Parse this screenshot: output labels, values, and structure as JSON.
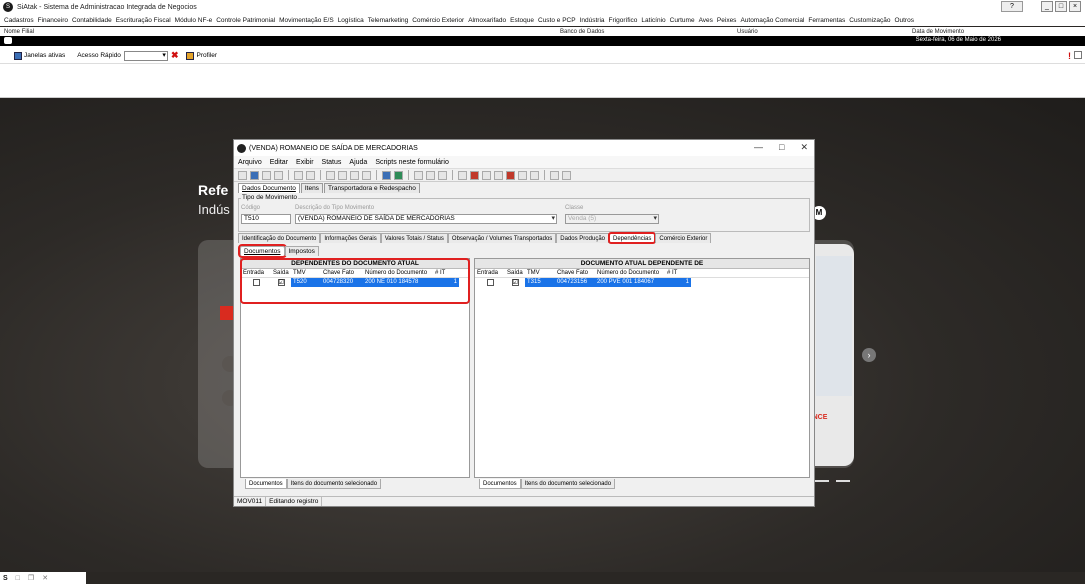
{
  "app": {
    "logo": "S",
    "title": "SiAtak - Sistema de Administracao Integrada de Negocios",
    "help_label": "?",
    "controls": [
      "_",
      "□",
      "×"
    ]
  },
  "menu": [
    "Cadastros",
    "Financeiro",
    "Contabilidade",
    "Escrituração Fiscal",
    "Módulo NF-e",
    "Controle Patrimonial",
    "Movimentação E/S",
    "Logística",
    "Telemarketing",
    "Comércio Exterior",
    "Almoxarifado",
    "Estoque",
    "Custo e PCP",
    "Indústria",
    "Frigorífico",
    "Laticínio",
    "Curtume",
    "Aves",
    "Peixes",
    "Automação Comercial",
    "Ferramentas",
    "Customização",
    "Outros"
  ],
  "info": {
    "nome_filial_label": "Nome Filial",
    "banco_label": "Banco de Dados",
    "usuario_label": "Usuário",
    "data_label": "Data de Movimento",
    "data_value": "Sexta-feira, 06 de Maio de 2026"
  },
  "toolbar": {
    "janelas_label": "Janelas ativas",
    "acesso_label": "Acesso Rápido",
    "profiler_label": "Profiler",
    "alert_icon": "!"
  },
  "background": {
    "title": "Refe",
    "subtitle": "Indús",
    "badge_text": "IENCE",
    "chevron": "M",
    "arrow": "›"
  },
  "dialog": {
    "title": "(VENDA) ROMANEIO DE SAÍDA DE MERCADORIAS",
    "controls": [
      "—",
      "□",
      "✕"
    ],
    "menu": [
      "Arquivo",
      "Editar",
      "Exibir",
      "Status",
      "Ajuda",
      "Scripts neste formulário"
    ],
    "main_tabs": [
      "Dados Documento",
      "Itens",
      "Transportadora e Redespacho"
    ],
    "group_label": "Tipo de Movimento",
    "codigo_label": "Código",
    "codigo_value": "T510",
    "descricao_label": "Descrição do Tipo Movimento",
    "descricao_value": "(VENDA) ROMANEIO DE SAÍDA DE MERCADORIAS",
    "classe_label": "Classe",
    "classe_value": "Venda (5)",
    "sub_tabs": [
      "Identificação do Documento",
      "Informações Gerais",
      "Valores Totais / Status",
      "Observação / Volumes Transportados",
      "Dados Produção",
      "Dependências",
      "Comércio Exterior"
    ],
    "doc_tabs": [
      "Documentos",
      "Impostos"
    ],
    "left_panel": {
      "header": "DEPENDENTES DO DOCUMENTO ATUAL",
      "columns": [
        "Entrada",
        "Saída",
        "TMV",
        "Chave Fato",
        "Número do Documento",
        "# IT"
      ],
      "rows": [
        {
          "entrada": "",
          "saida": "☑",
          "tmv": "T520",
          "chave": "004728320",
          "numero": "200 NE 010 184578",
          "it": "1"
        }
      ],
      "footer_tabs": [
        "Documentos",
        "Itens do documento selecionado"
      ]
    },
    "right_panel": {
      "header": "DOCUMENTO ATUAL DEPENDENTE DE",
      "columns": [
        "Entrada",
        "Saída",
        "TMV",
        "Chave Fato",
        "Número do Documento",
        "# IT"
      ],
      "rows": [
        {
          "entrada": "",
          "saida": "☑",
          "tmv": "T315",
          "chave": "004723156",
          "numero": "200 PVE 001 184067",
          "it": "1"
        }
      ],
      "footer_tabs": [
        "Documentos",
        "Itens do documento selecionado"
      ]
    },
    "status": [
      "MOV011",
      "Editando registro"
    ]
  },
  "taskbar": {
    "items": [
      "S",
      "□",
      "❐",
      "✕"
    ]
  }
}
